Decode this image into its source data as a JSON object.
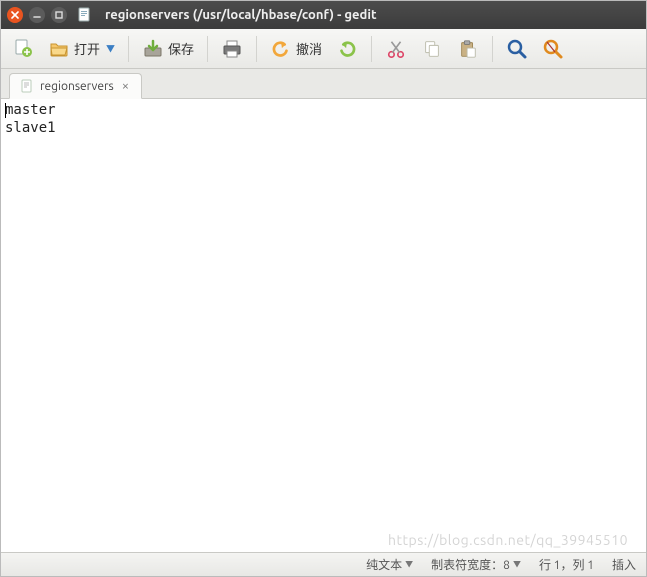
{
  "titlebar": {
    "title": "regionservers (/usr/local/hbase/conf) - gedit"
  },
  "toolbar": {
    "new_tooltip": "New",
    "open_label": "打开",
    "save_label": "保存",
    "print_tooltip": "Print",
    "undo_label": "撤消",
    "redo_tooltip": "Redo",
    "cut_tooltip": "Cut",
    "copy_tooltip": "Copy",
    "paste_tooltip": "Paste",
    "find_tooltip": "Find",
    "replace_tooltip": "Find and Replace"
  },
  "tabs": [
    {
      "label": "regionservers"
    }
  ],
  "editor": {
    "content": "master\nslave1"
  },
  "statusbar": {
    "syntax_label": "纯文本",
    "tabwidth_label": "制表符宽度：8",
    "position_label": "行 1，列 1",
    "insert_label": "插入"
  },
  "watermark": "https://blog.csdn.net/qq_39945510"
}
